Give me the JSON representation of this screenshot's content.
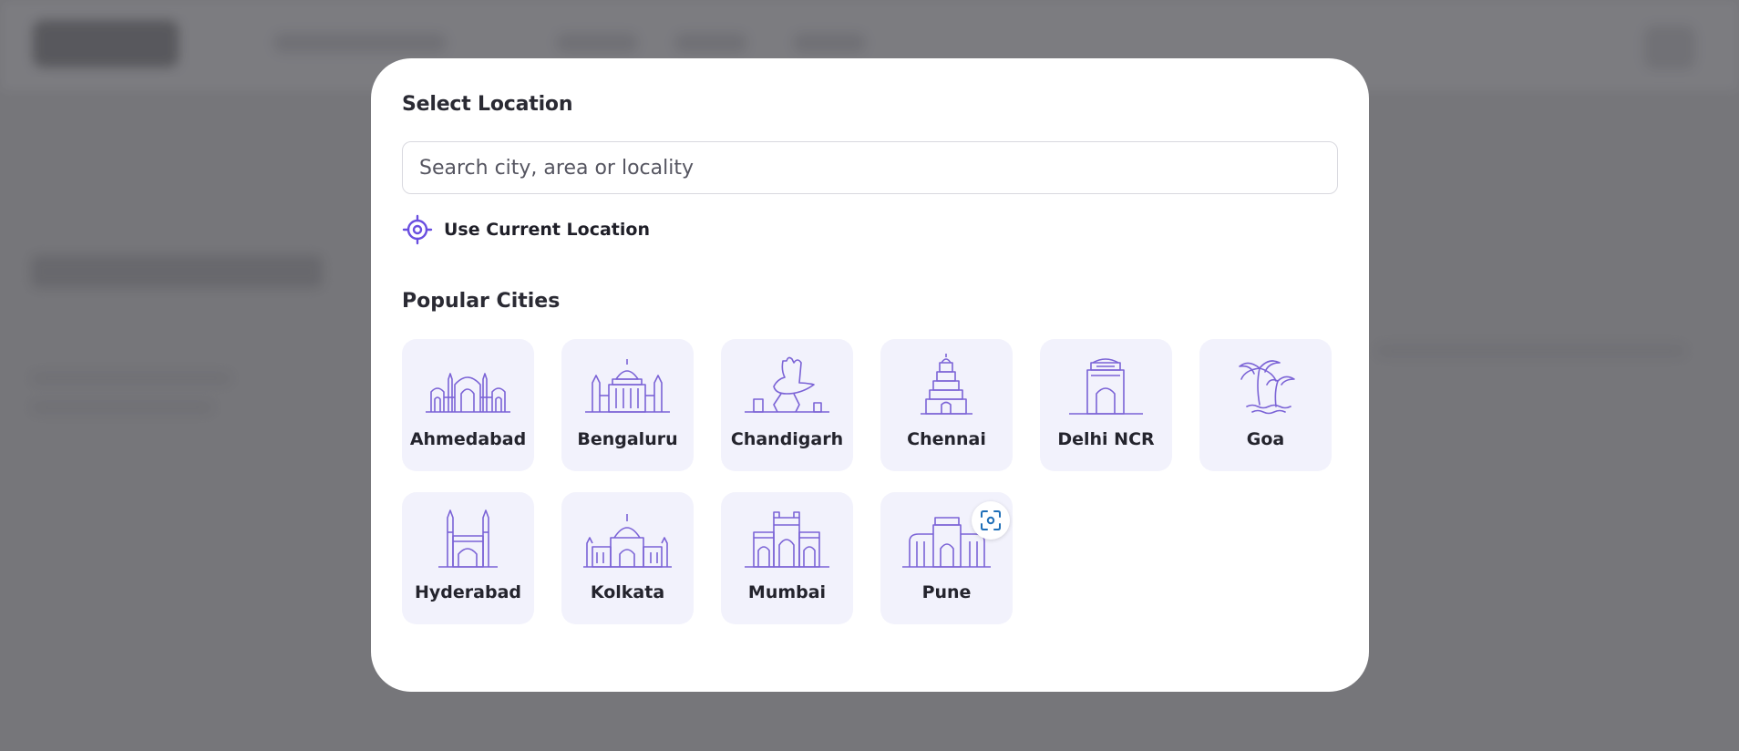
{
  "modal": {
    "title": "Select Location",
    "search": {
      "placeholder": "Search city, area or locality",
      "value": ""
    },
    "use_current_location_label": "Use Current Location",
    "popular_cities_title": "Popular Cities",
    "cities": [
      {
        "name": "Ahmedabad",
        "icon": "ahmedabad-landmark-icon"
      },
      {
        "name": "Bengaluru",
        "icon": "bengaluru-landmark-icon"
      },
      {
        "name": "Chandigarh",
        "icon": "chandigarh-landmark-icon"
      },
      {
        "name": "Chennai",
        "icon": "chennai-temple-icon"
      },
      {
        "name": "Delhi NCR",
        "icon": "india-gate-icon"
      },
      {
        "name": "Goa",
        "icon": "palm-tree-icon"
      },
      {
        "name": "Hyderabad",
        "icon": "charminar-icon"
      },
      {
        "name": "Kolkata",
        "icon": "victoria-memorial-icon"
      },
      {
        "name": "Mumbai",
        "icon": "gateway-of-india-icon"
      },
      {
        "name": "Pune",
        "icon": "shaniwar-wada-icon"
      }
    ]
  },
  "colors": {
    "accent": "#6a4fe0",
    "icon_stroke": "#7b63d6",
    "tile_bg": "#f2f2fc",
    "scan_icon": "#1f6fb8"
  }
}
